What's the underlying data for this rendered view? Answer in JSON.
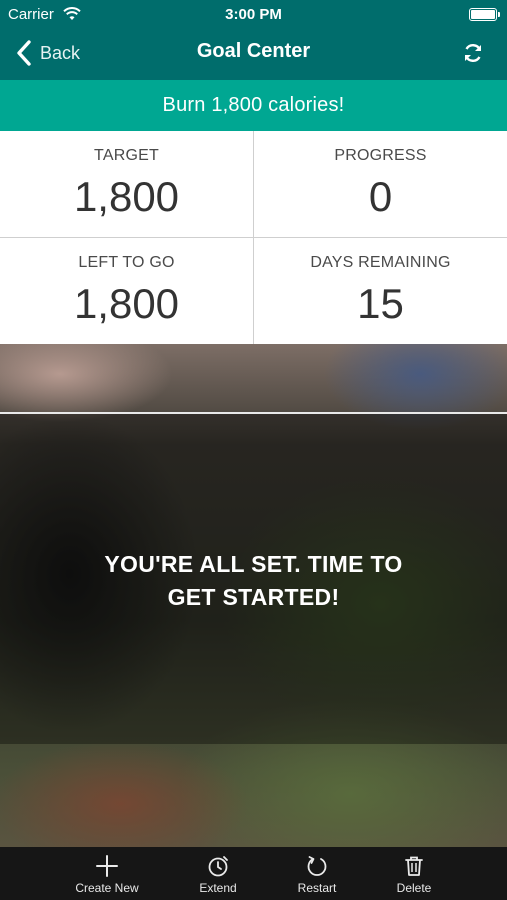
{
  "status_bar": {
    "carrier": "Carrier",
    "time": "3:00 PM"
  },
  "nav": {
    "back_label": "Back",
    "title": "Goal Center"
  },
  "goal": {
    "text": "Burn 1,800 calories!"
  },
  "stats": {
    "target_label": "TARGET",
    "target_value": "1,800",
    "progress_label": "PROGRESS",
    "progress_value": "0",
    "left_label": "LEFT TO GO",
    "left_value": "1,800",
    "days_label": "DAYS REMAINING",
    "days_value": "15"
  },
  "message": {
    "line1": "YOU'RE ALL SET. TIME TO",
    "line2": "GET STARTED!"
  },
  "toolbar": {
    "create_label": "Create New",
    "extend_label": "Extend",
    "restart_label": "Restart",
    "delete_label": "Delete"
  },
  "icons": {
    "back": "chevron-left-icon",
    "refresh": "refresh-icon",
    "create": "plus-icon",
    "extend": "timer-icon",
    "restart": "restart-icon",
    "delete": "trash-icon"
  },
  "colors": {
    "nav_bg": "#006d6c",
    "goal_banner_bg": "#00a792",
    "toolbar_bg": "#161616"
  }
}
